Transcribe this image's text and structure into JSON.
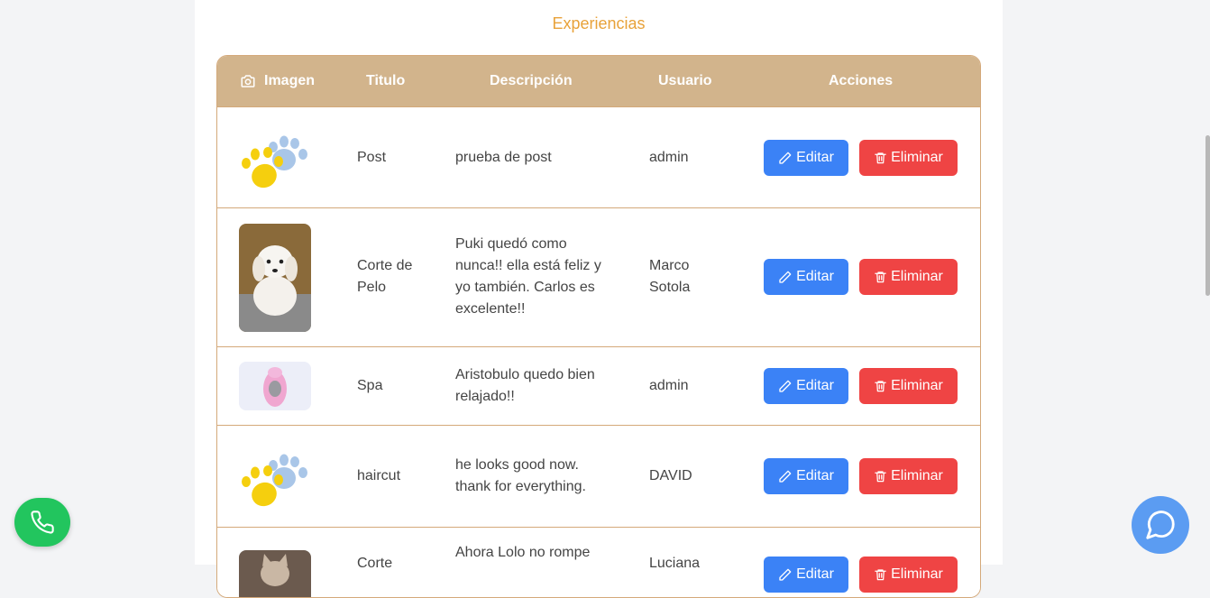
{
  "section": {
    "title": "Experiencias"
  },
  "table": {
    "headers": {
      "image": "Imagen",
      "title": "Titulo",
      "description": "Descripción",
      "user": "Usuario",
      "actions": "Acciones"
    },
    "rows": [
      {
        "image": "paw-logo",
        "title": "Post",
        "description": "prueba de post",
        "user": "admin"
      },
      {
        "image": "white-puppy-photo",
        "title": "Corte de Pelo",
        "description": "Puki quedó como nunca!! ella está feliz y yo también. Carlos es excelente!!",
        "user": "Marco Sotola"
      },
      {
        "image": "pet-in-pink-hoodie-photo",
        "title": "Spa",
        "description": "Aristobulo quedo bien relajado!!",
        "user": "admin"
      },
      {
        "image": "paw-logo",
        "title": "haircut",
        "description": "he looks good now. thank for everything.",
        "user": "DAVID"
      },
      {
        "image": "cat-photo",
        "title": "Corte",
        "description": "Ahora Lolo no rompe",
        "user": "Luciana"
      }
    ],
    "edit_label": "Editar",
    "delete_label": "Eliminar"
  },
  "icons": {
    "header_image": "camera-icon",
    "edit": "pencil-icon",
    "delete": "trash-icon",
    "phone": "phone-icon",
    "chat": "chat-icon"
  },
  "colors": {
    "header": "#d2b48c",
    "title": "#e8a23a",
    "edit": "#3b82f6",
    "delete": "#ef4444",
    "phone_fab": "#22c55e",
    "chat_fab": "#5b9cf2"
  }
}
